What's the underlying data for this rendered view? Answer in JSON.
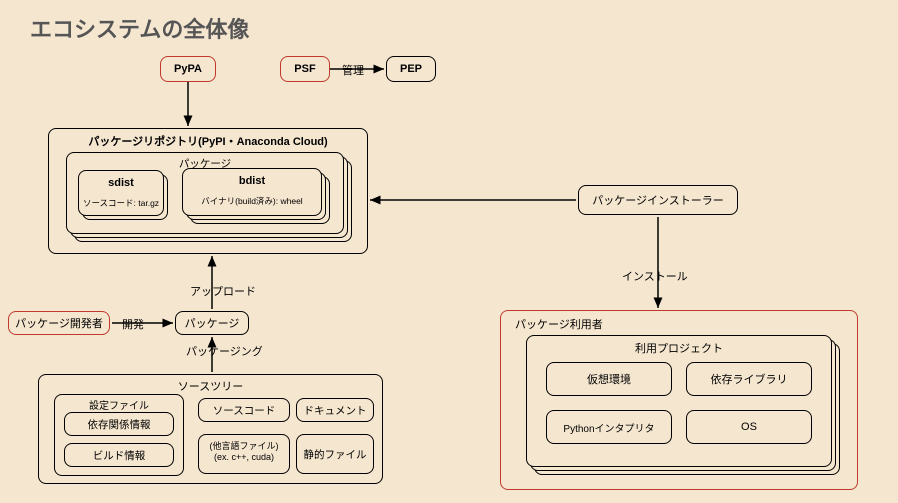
{
  "title": "エコシステムの全体像",
  "top": {
    "pypa": "PyPA",
    "psf": "PSF",
    "pep": "PEP",
    "manage": "管理"
  },
  "repo": {
    "title": "パッケージリポジトリ(PyPI・Anaconda Cloud)",
    "pkg": "パッケージ",
    "sdist": "sdist",
    "sdist_note": "ソースコード: tar.gz",
    "bdist": "bdist",
    "bdist_note": "バイナリ(build済み): wheel"
  },
  "upload": "アップロード",
  "developer": "パッケージ開発者",
  "develop": "開発",
  "package_mid": "パッケージ",
  "packaging": "パッケージング",
  "srctree": {
    "title": "ソースツリー",
    "settings": "設定ファイル",
    "deps": "依存関係情報",
    "build": "ビルド情報",
    "source": "ソースコード",
    "doc": "ドキュメント",
    "other1": "(他言語ファイル)",
    "other2": "(ex. c++, cuda)",
    "static": "静的ファイル"
  },
  "installer": "パッケージインストーラー",
  "install": "インストール",
  "user": {
    "title": "パッケージ利用者",
    "project": "利用プロジェクト",
    "venv": "仮想環境",
    "deps": "依存ライブラリ",
    "python": "Pythonインタプリタ",
    "os": "OS"
  }
}
